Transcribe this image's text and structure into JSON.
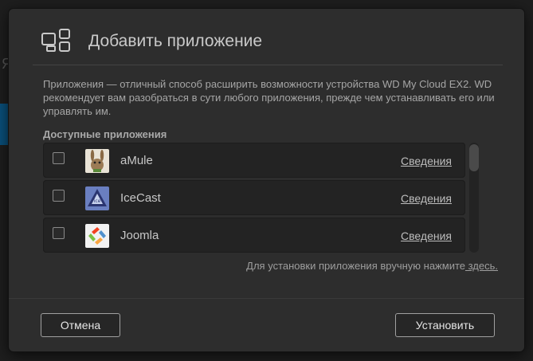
{
  "dialog": {
    "title": "Добавить приложение",
    "description": "Приложения — отличный способ расширить возможности устройства WD My Cloud EX2. WD рекомендует вам разобраться в сути любого приложения, прежде чем устанавливать его или управлять им.",
    "section_label": "Доступные приложения",
    "apps": [
      {
        "name": "aMule",
        "details_label": "Сведения",
        "checked": false,
        "icon": "amule-icon"
      },
      {
        "name": "IceCast",
        "details_label": "Сведения",
        "checked": false,
        "icon": "icecast-icon"
      },
      {
        "name": "Joomla",
        "details_label": "Сведения",
        "checked": false,
        "icon": "joomla-icon"
      }
    ],
    "manual_install_text": "Для установки приложения вручную нажмите",
    "manual_install_link": " здесь.",
    "cancel_label": "Отмена",
    "install_label": "Установить"
  },
  "colors": {
    "dialog_bg": "#2d2d2d",
    "row_bg": "#232323",
    "text": "#bdbdbd"
  }
}
